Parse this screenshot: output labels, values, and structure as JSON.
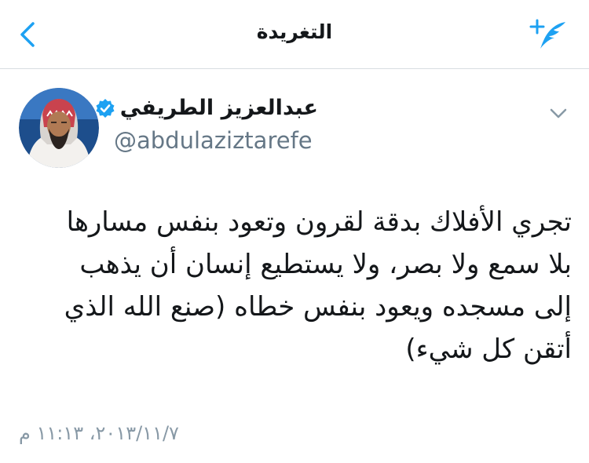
{
  "navbar": {
    "title": "التغريدة",
    "back_icon": "chevron-left-icon",
    "compose_icon": "compose-tweet-icon"
  },
  "tweet": {
    "author_name": "عبدالعزيز الطريفي",
    "handle": "@abdulaziztarefe",
    "verified": true,
    "text_lines": [
      "تجري الأفلاك بدقة لقرون وتعود بنفس مسارها",
      "بلا سمع ولا بصر، ولا يستطيع إنسان أن يذهب",
      "إلى مسجده ويعود بنفس خطاه (صنع الله الذي",
      "أتقن كل شيء)"
    ],
    "timestamp": "٢٠١٣/١١/٧، ١١:١٣ م"
  },
  "colors": {
    "accent": "#1da1f2",
    "text": "#14171a",
    "secondary": "#657786",
    "divider": "#d8dde1"
  }
}
